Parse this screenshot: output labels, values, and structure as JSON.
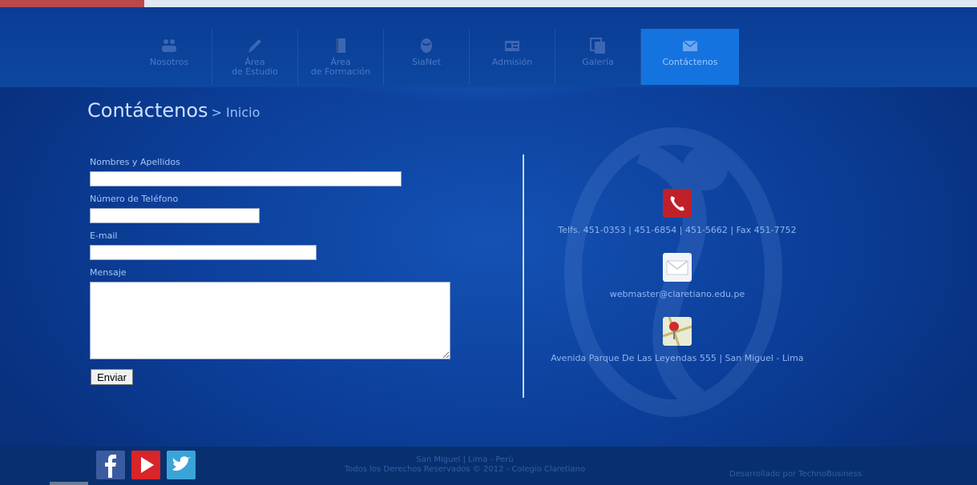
{
  "nav": {
    "items": [
      {
        "label": "Nosotros",
        "icon": "people-icon"
      },
      {
        "label": "Área\nde Estudio",
        "icon": "pencil-icon"
      },
      {
        "label": "Área\nde Formación",
        "icon": "book-icon"
      },
      {
        "label": "SiaNet",
        "icon": "sianet-icon"
      },
      {
        "label": "Admisión",
        "icon": "id-card-icon"
      },
      {
        "label": "Galería",
        "icon": "gallery-icon"
      },
      {
        "label": "Contáctenos",
        "icon": "envelope-icon"
      }
    ],
    "active": "Contáctenos"
  },
  "page": {
    "title": "Contáctenos",
    "breadcrumb": "> Inicio"
  },
  "form": {
    "name_label": "Nombres y Apellidos",
    "phone_label": "Número de Teléfono",
    "email_label": "E-mail",
    "message_label": "Mensaje",
    "name_value": "",
    "phone_value": "",
    "email_value": "",
    "message_value": "",
    "submit_label": "Enviar"
  },
  "contact": {
    "phones": "Telfs. 451-0353 | 451-6854 | 451-5662 | Fax 451-7752",
    "email": "webmaster@claretiano.edu.pe",
    "address": "Avenida Parque De Las Leyendas 555 | San Miguel - Lima"
  },
  "footer": {
    "location": "San Miguel | Lima - Perú",
    "rights": "Todos los Derechos Reservados © 2012 - Colegio Claretiano",
    "developer": "Desarrollado por TechnoBusiness"
  },
  "social": [
    "facebook-icon",
    "youtube-icon",
    "twitter-icon"
  ],
  "colors": {
    "background": "#0b3f9a",
    "nav_active": "#1573e0",
    "phone_icon": "#c0202a",
    "label_text": "#a6c7f5"
  }
}
